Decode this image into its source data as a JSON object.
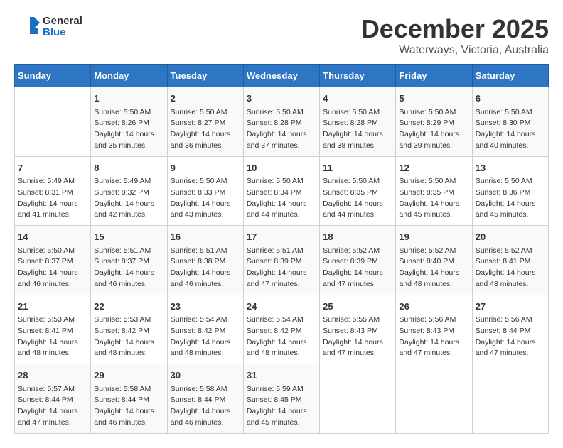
{
  "logo": {
    "text_general": "General",
    "text_blue": "Blue"
  },
  "header": {
    "month": "December 2025",
    "location": "Waterways, Victoria, Australia"
  },
  "weekdays": [
    "Sunday",
    "Monday",
    "Tuesday",
    "Wednesday",
    "Thursday",
    "Friday",
    "Saturday"
  ],
  "weeks": [
    [
      {
        "day": "",
        "sunrise": "",
        "sunset": "",
        "daylight": ""
      },
      {
        "day": "1",
        "sunrise": "Sunrise: 5:50 AM",
        "sunset": "Sunset: 8:26 PM",
        "daylight": "Daylight: 14 hours and 35 minutes."
      },
      {
        "day": "2",
        "sunrise": "Sunrise: 5:50 AM",
        "sunset": "Sunset: 8:27 PM",
        "daylight": "Daylight: 14 hours and 36 minutes."
      },
      {
        "day": "3",
        "sunrise": "Sunrise: 5:50 AM",
        "sunset": "Sunset: 8:28 PM",
        "daylight": "Daylight: 14 hours and 37 minutes."
      },
      {
        "day": "4",
        "sunrise": "Sunrise: 5:50 AM",
        "sunset": "Sunset: 8:28 PM",
        "daylight": "Daylight: 14 hours and 38 minutes."
      },
      {
        "day": "5",
        "sunrise": "Sunrise: 5:50 AM",
        "sunset": "Sunset: 8:29 PM",
        "daylight": "Daylight: 14 hours and 39 minutes."
      },
      {
        "day": "6",
        "sunrise": "Sunrise: 5:50 AM",
        "sunset": "Sunset: 8:30 PM",
        "daylight": "Daylight: 14 hours and 40 minutes."
      }
    ],
    [
      {
        "day": "7",
        "sunrise": "Sunrise: 5:49 AM",
        "sunset": "Sunset: 8:31 PM",
        "daylight": "Daylight: 14 hours and 41 minutes."
      },
      {
        "day": "8",
        "sunrise": "Sunrise: 5:49 AM",
        "sunset": "Sunset: 8:32 PM",
        "daylight": "Daylight: 14 hours and 42 minutes."
      },
      {
        "day": "9",
        "sunrise": "Sunrise: 5:50 AM",
        "sunset": "Sunset: 8:33 PM",
        "daylight": "Daylight: 14 hours and 43 minutes."
      },
      {
        "day": "10",
        "sunrise": "Sunrise: 5:50 AM",
        "sunset": "Sunset: 8:34 PM",
        "daylight": "Daylight: 14 hours and 44 minutes."
      },
      {
        "day": "11",
        "sunrise": "Sunrise: 5:50 AM",
        "sunset": "Sunset: 8:35 PM",
        "daylight": "Daylight: 14 hours and 44 minutes."
      },
      {
        "day": "12",
        "sunrise": "Sunrise: 5:50 AM",
        "sunset": "Sunset: 8:35 PM",
        "daylight": "Daylight: 14 hours and 45 minutes."
      },
      {
        "day": "13",
        "sunrise": "Sunrise: 5:50 AM",
        "sunset": "Sunset: 8:36 PM",
        "daylight": "Daylight: 14 hours and 45 minutes."
      }
    ],
    [
      {
        "day": "14",
        "sunrise": "Sunrise: 5:50 AM",
        "sunset": "Sunset: 8:37 PM",
        "daylight": "Daylight: 14 hours and 46 minutes."
      },
      {
        "day": "15",
        "sunrise": "Sunrise: 5:51 AM",
        "sunset": "Sunset: 8:37 PM",
        "daylight": "Daylight: 14 hours and 46 minutes."
      },
      {
        "day": "16",
        "sunrise": "Sunrise: 5:51 AM",
        "sunset": "Sunset: 8:38 PM",
        "daylight": "Daylight: 14 hours and 46 minutes."
      },
      {
        "day": "17",
        "sunrise": "Sunrise: 5:51 AM",
        "sunset": "Sunset: 8:39 PM",
        "daylight": "Daylight: 14 hours and 47 minutes."
      },
      {
        "day": "18",
        "sunrise": "Sunrise: 5:52 AM",
        "sunset": "Sunset: 8:39 PM",
        "daylight": "Daylight: 14 hours and 47 minutes."
      },
      {
        "day": "19",
        "sunrise": "Sunrise: 5:52 AM",
        "sunset": "Sunset: 8:40 PM",
        "daylight": "Daylight: 14 hours and 48 minutes."
      },
      {
        "day": "20",
        "sunrise": "Sunrise: 5:52 AM",
        "sunset": "Sunset: 8:41 PM",
        "daylight": "Daylight: 14 hours and 48 minutes."
      }
    ],
    [
      {
        "day": "21",
        "sunrise": "Sunrise: 5:53 AM",
        "sunset": "Sunset: 8:41 PM",
        "daylight": "Daylight: 14 hours and 48 minutes."
      },
      {
        "day": "22",
        "sunrise": "Sunrise: 5:53 AM",
        "sunset": "Sunset: 8:42 PM",
        "daylight": "Daylight: 14 hours and 48 minutes."
      },
      {
        "day": "23",
        "sunrise": "Sunrise: 5:54 AM",
        "sunset": "Sunset: 8:42 PM",
        "daylight": "Daylight: 14 hours and 48 minutes."
      },
      {
        "day": "24",
        "sunrise": "Sunrise: 5:54 AM",
        "sunset": "Sunset: 8:42 PM",
        "daylight": "Daylight: 14 hours and 48 minutes."
      },
      {
        "day": "25",
        "sunrise": "Sunrise: 5:55 AM",
        "sunset": "Sunset: 8:43 PM",
        "daylight": "Daylight: 14 hours and 47 minutes."
      },
      {
        "day": "26",
        "sunrise": "Sunrise: 5:56 AM",
        "sunset": "Sunset: 8:43 PM",
        "daylight": "Daylight: 14 hours and 47 minutes."
      },
      {
        "day": "27",
        "sunrise": "Sunrise: 5:56 AM",
        "sunset": "Sunset: 8:44 PM",
        "daylight": "Daylight: 14 hours and 47 minutes."
      }
    ],
    [
      {
        "day": "28",
        "sunrise": "Sunrise: 5:57 AM",
        "sunset": "Sunset: 8:44 PM",
        "daylight": "Daylight: 14 hours and 47 minutes."
      },
      {
        "day": "29",
        "sunrise": "Sunrise: 5:58 AM",
        "sunset": "Sunset: 8:44 PM",
        "daylight": "Daylight: 14 hours and 46 minutes."
      },
      {
        "day": "30",
        "sunrise": "Sunrise: 5:58 AM",
        "sunset": "Sunset: 8:44 PM",
        "daylight": "Daylight: 14 hours and 46 minutes."
      },
      {
        "day": "31",
        "sunrise": "Sunrise: 5:59 AM",
        "sunset": "Sunset: 8:45 PM",
        "daylight": "Daylight: 14 hours and 45 minutes."
      },
      {
        "day": "",
        "sunrise": "",
        "sunset": "",
        "daylight": ""
      },
      {
        "day": "",
        "sunrise": "",
        "sunset": "",
        "daylight": ""
      },
      {
        "day": "",
        "sunrise": "",
        "sunset": "",
        "daylight": ""
      }
    ]
  ]
}
